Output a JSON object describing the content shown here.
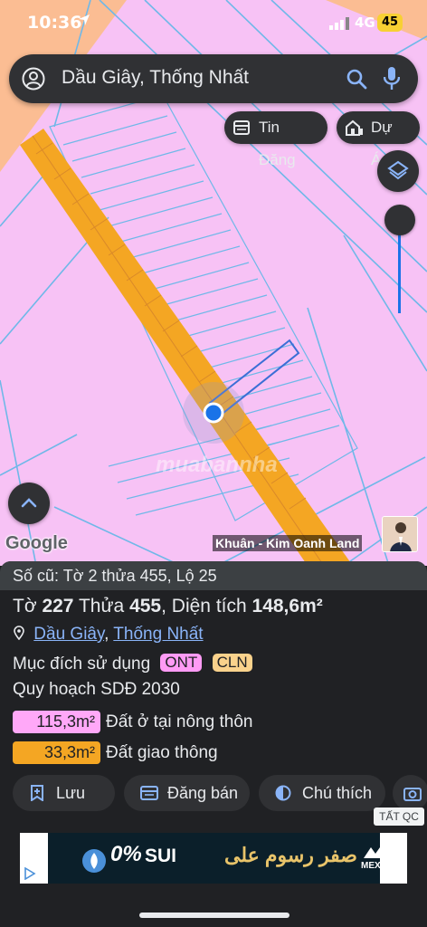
{
  "status_bar": {
    "time": "10:36",
    "network": "4G",
    "battery": "45"
  },
  "search": {
    "query": "Dầu Giây, Thống Nhất"
  },
  "chips": [
    {
      "label": "Tin Đăng"
    },
    {
      "label": "Dự Án"
    }
  ],
  "map": {
    "attribution": "Google",
    "owner_label": "Khuân - Kim Oanh Land",
    "watermark": "muabannha"
  },
  "parcel": {
    "old_ref": "Số cũ: Tờ 2 thửa 455, Lộ 25",
    "sheet_label": "Tờ",
    "sheet": "227",
    "plot_label": "Thửa",
    "plot": "455",
    "area_label": "Diện tích",
    "area": "148,6m²",
    "district": "Dầu Giây",
    "province": "Thống Nhất",
    "location_sep": ",",
    "use_label": "Mục đích sử dụng",
    "use_tags": [
      {
        "code": "ONT",
        "color": "#ff9bf5"
      },
      {
        "code": "CLN",
        "color": "#fad28c"
      }
    ],
    "plan_label": "Quy hoạch SDĐ 2030",
    "plan_areas": [
      {
        "value": "115,3m²",
        "label": "Đất ở tại nông thôn",
        "color": "#ffa8f8"
      },
      {
        "value": "33,3m²",
        "label": "Đất giao thông",
        "color": "#f4a623"
      }
    ]
  },
  "actions": [
    {
      "label": "Lưu"
    },
    {
      "label": "Đăng bán"
    },
    {
      "label": "Chú thích"
    }
  ],
  "ad": {
    "close_label": "TẤT QC",
    "headline": "SUI",
    "arabic_text": "صفر رسوم على",
    "percent": "0%",
    "brand": "MEXC"
  },
  "colors": {
    "map_bg": "#f7c2f5",
    "road": "#f4a623",
    "parcel_line": "#6fb8e8",
    "accent": "#1a73e8",
    "panel": "#202124"
  }
}
